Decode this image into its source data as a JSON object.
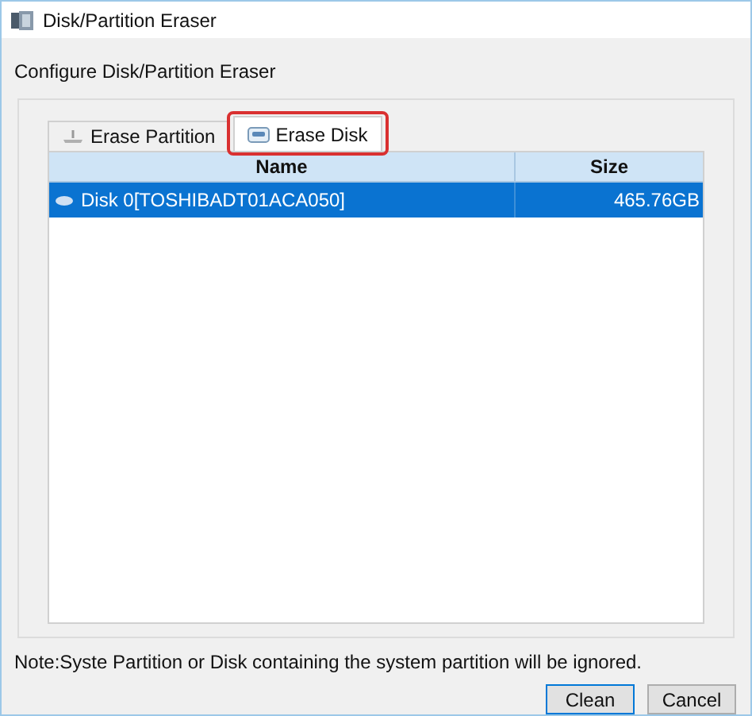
{
  "window": {
    "title": "Disk/Partition Eraser"
  },
  "heading": "Configure Disk/Partition Eraser",
  "tabs": [
    {
      "label": "Erase Partition",
      "selected": false,
      "highlighted": false
    },
    {
      "label": "Erase Disk",
      "selected": true,
      "highlighted": true
    }
  ],
  "table": {
    "columns": [
      "Name",
      "Size"
    ],
    "rows": [
      {
        "name": "Disk 0[TOSHIBADT01ACA050]",
        "size": "465.76GB",
        "selected": true
      }
    ]
  },
  "note": "Note:Syste Partition or Disk containing the system partition will be ignored.",
  "buttons": [
    {
      "label": "Clean",
      "default": true
    },
    {
      "label": "Cancel",
      "default": false
    }
  ]
}
